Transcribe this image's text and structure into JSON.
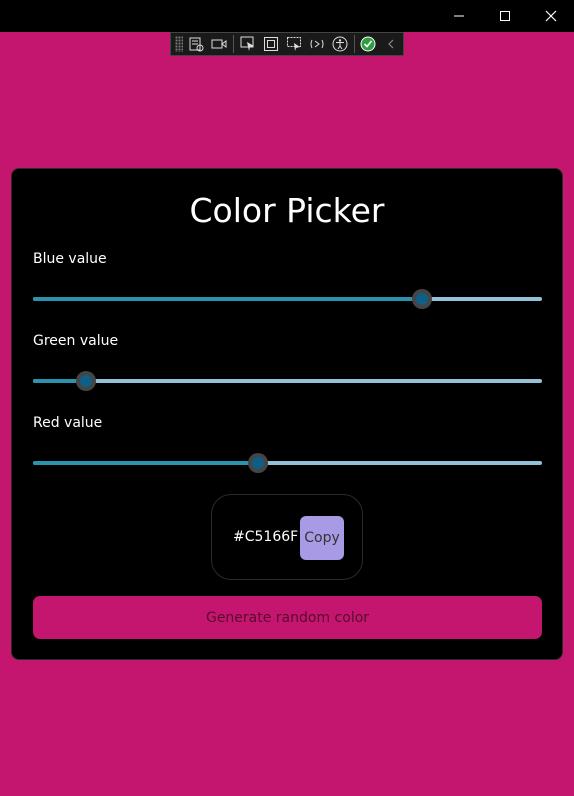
{
  "window": {
    "minimize_icon": "minimize-icon",
    "maximize_icon": "maximize-icon",
    "close_icon": "close-icon"
  },
  "toolbar": {
    "icons": [
      "live-visual-tree-icon",
      "record-icon",
      "select-element-icon",
      "display-layout-adorners-icon",
      "track-focus-icon",
      "hot-reload-icon",
      "accessibility-icon",
      "check-icon",
      "collapse-chevron-icon"
    ]
  },
  "app": {
    "title": "Color Picker",
    "sliders": [
      {
        "label": "Blue value",
        "value_fraction": 0.765
      },
      {
        "label": "Green value",
        "value_fraction": 0.104
      },
      {
        "label": "Red value",
        "value_fraction": 0.442
      }
    ],
    "hex_value": "#C5166F",
    "copy_label": "Copy",
    "generate_label": "Generate random color"
  },
  "colors": {
    "background": "#C5166F",
    "card": "#000000",
    "slider_fill": "#2C93AE",
    "slider_track": "#93C1D8",
    "copy_button": "#A99AE5",
    "generate_button": "#C5166F"
  }
}
